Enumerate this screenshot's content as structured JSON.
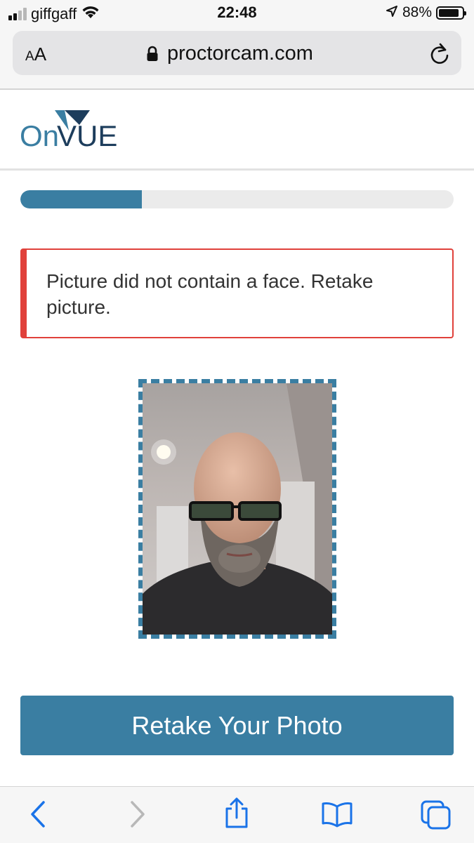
{
  "status_bar": {
    "carrier": "giffgaff",
    "time": "22:48",
    "battery_percent": "88%",
    "battery_level": 0.88,
    "signal_bars_filled": 2,
    "signal_bars_total": 4,
    "icons": [
      "signal-icon",
      "wifi-icon",
      "location-arrow-icon",
      "battery-icon"
    ]
  },
  "browser": {
    "text_size_button": "AA",
    "url": "proctorcam.com",
    "icons": [
      "lock-icon",
      "reload-icon"
    ]
  },
  "header": {
    "logo_text_on": "On",
    "logo_text_vue": "VUE",
    "colors": {
      "on": "#3a7ea2",
      "vue": "#1d3d5c",
      "v_triangle": "#3a7ea2"
    }
  },
  "progress": {
    "value": 0.28,
    "color": "#3a7ea2"
  },
  "alert": {
    "message": "Picture did not contain a face. Retake picture.",
    "border_color": "#e0413b"
  },
  "photo": {
    "description_icon": "captured-photo",
    "frame_color": "#3a7ea2"
  },
  "actions": {
    "retake_label": "Retake Your Photo",
    "button_color": "#3a7ea2"
  },
  "toolbar": {
    "icons": [
      "back-icon",
      "forward-icon",
      "share-icon",
      "bookmarks-icon",
      "tabs-icon"
    ],
    "accent": "#1a73e8"
  }
}
